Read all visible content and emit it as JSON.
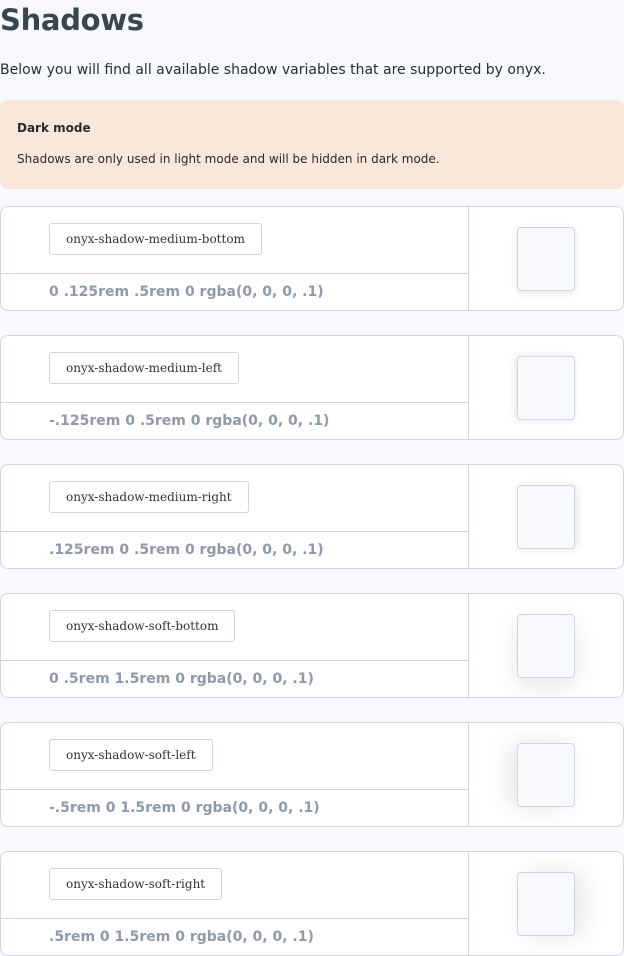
{
  "page": {
    "title": "Shadows",
    "intro": "Below you will find all available shadow variables that are supported by onyx."
  },
  "callout": {
    "title": "Dark mode",
    "text": "Shadows are only used in light mode and will be hidden in dark mode."
  },
  "shadows": [
    {
      "name": "onyx-shadow-medium-bottom",
      "value": "0 .125rem .5rem 0 rgba(0, 0, 0, .1)"
    },
    {
      "name": "onyx-shadow-medium-left",
      "value": "-.125rem 0 .5rem 0 rgba(0, 0, 0, .1)"
    },
    {
      "name": "onyx-shadow-medium-right",
      "value": ".125rem 0 .5rem 0 rgba(0, 0, 0, .1)"
    },
    {
      "name": "onyx-shadow-soft-bottom",
      "value": "0 .5rem 1.5rem 0 rgba(0, 0, 0, .1)"
    },
    {
      "name": "onyx-shadow-soft-left",
      "value": "-.5rem 0 1.5rem 0 rgba(0, 0, 0, .1)"
    },
    {
      "name": "onyx-shadow-soft-right",
      "value": ".5rem 0 1.5rem 0 rgba(0, 0, 0, .1)"
    }
  ]
}
